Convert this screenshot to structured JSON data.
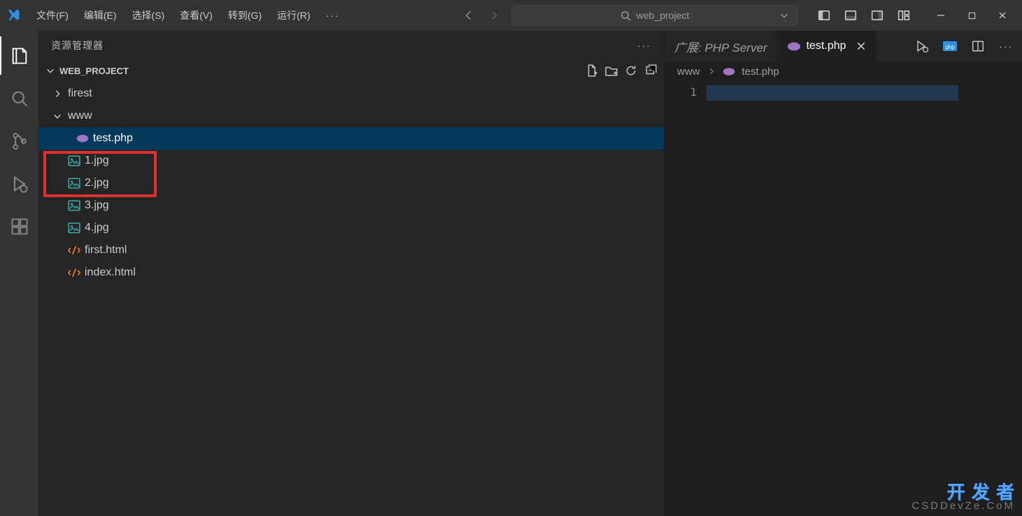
{
  "menu": {
    "file": "文件(F)",
    "edit": "编辑(E)",
    "select": "选择(S)",
    "view": "查看(V)",
    "goto": "转到(G)",
    "run": "运行(R)"
  },
  "search_placeholder": "web_project",
  "sidebar": {
    "title": "资源管理器",
    "project": "WEB_PROJECT",
    "tree": {
      "firest": "firest",
      "www": "www",
      "test_php": "test.php",
      "jpg1": "1.jpg",
      "jpg2": "2.jpg",
      "jpg3": "3.jpg",
      "jpg4": "4.jpg",
      "first_html": "first.html",
      "index_html": "index.html"
    }
  },
  "editor": {
    "extension_label": "广展: PHP Server",
    "tab_label": "test.php",
    "breadcrumb_www": "www",
    "breadcrumb_file": "test.php",
    "line_number": "1"
  },
  "watermark": {
    "line1": "开 发 者",
    "line2": "CSDDevZe.CoM"
  },
  "colors": {
    "php_purple": "#a074c4",
    "image_teal": "#3aa9a4",
    "html_orange": "#e37933",
    "file_blue": "#2f8fe0"
  }
}
